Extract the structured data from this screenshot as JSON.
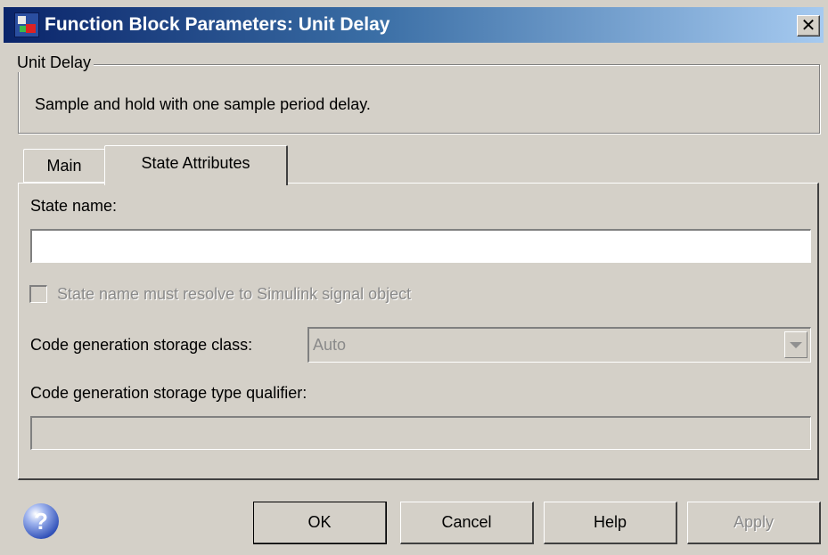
{
  "window": {
    "title": "Function Block Parameters: Unit Delay",
    "close_glyph": "✕"
  },
  "group": {
    "legend": "Unit Delay",
    "description": "Sample and hold with one sample period delay."
  },
  "tabs": [
    {
      "label": "Main",
      "selected": false
    },
    {
      "label": "State Attributes",
      "selected": true
    }
  ],
  "state_attributes": {
    "state_name_label": "State name:",
    "state_name_value": "",
    "resolve_checkbox_label": "State name must resolve to Simulink signal object",
    "resolve_checkbox_checked": false,
    "storage_class_label": "Code generation storage class:",
    "storage_class_value": "Auto",
    "type_qualifier_label": "Code generation storage type qualifier:",
    "type_qualifier_value": ""
  },
  "buttons": {
    "ok": "OK",
    "cancel": "Cancel",
    "help": "Help",
    "apply": "Apply"
  },
  "icons": {
    "help": "help-question-icon",
    "help_glyph": "?"
  }
}
